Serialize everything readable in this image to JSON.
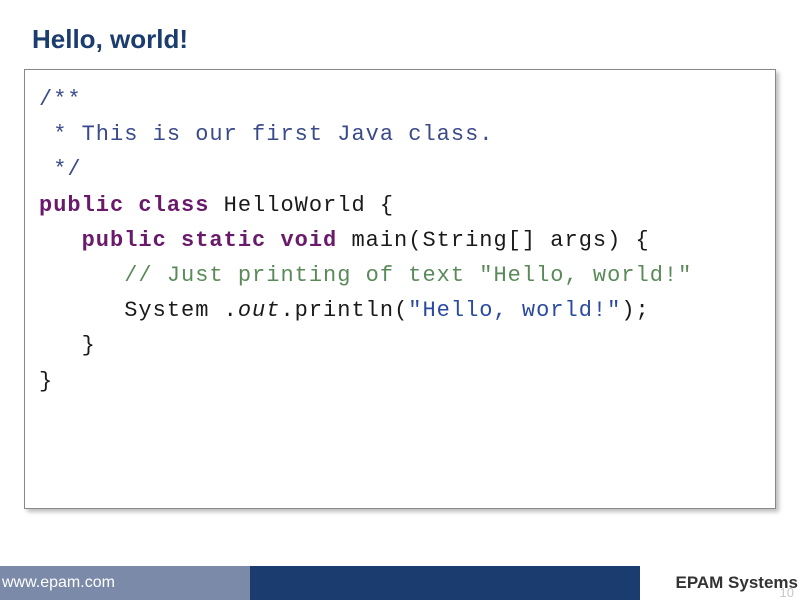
{
  "title": "Hello, world!",
  "code": {
    "l1": "/**",
    "l2_pre": " * ",
    "l2_text": "This is our first Java class.",
    "l3": " */",
    "l4_kw": "public class ",
    "l4_name": "HelloWorld {",
    "l5": "",
    "l6_indent": "   ",
    "l6_kw": "public static void ",
    "l6_sig": "main(String[] args) {",
    "l7_indent": "      ",
    "l7_comment": "// Just printing of text \"Hello, world!\"",
    "l8_indent": "      ",
    "l8_a": "System .",
    "l8_out": "out",
    "l8_b": ".println(",
    "l8_str": "\"Hello, world!\"",
    "l8_c": ");",
    "l9_indent": "   ",
    "l9_brace": "}",
    "l10_brace": "}"
  },
  "footer": {
    "url": "www.epam.com",
    "company": "EPAM Systems",
    "page": "10"
  }
}
